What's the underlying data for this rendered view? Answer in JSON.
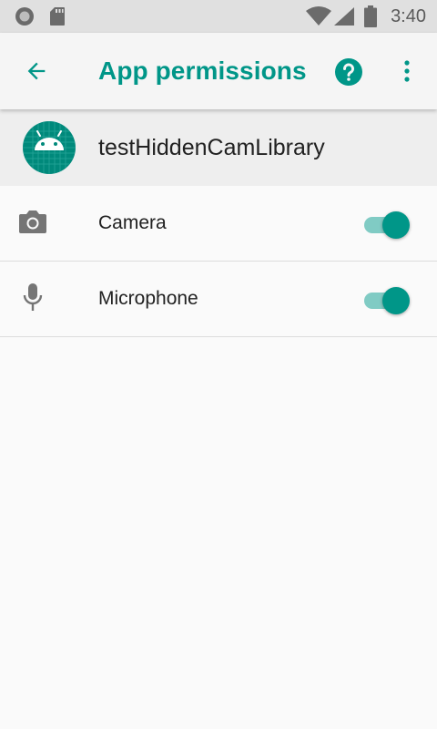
{
  "status_bar": {
    "time": "3:40",
    "icons": [
      "notification-dot-icon",
      "sd-card-icon",
      "wifi-icon",
      "cell-signal-icon",
      "battery-icon"
    ]
  },
  "app_bar": {
    "title": "App permissions",
    "back_icon": "arrow-back-icon",
    "help_icon": "help-icon",
    "menu_icon": "more-vert-icon"
  },
  "app": {
    "name": "testHiddenCamLibrary",
    "icon": "android-icon"
  },
  "permissions": [
    {
      "label": "Camera",
      "icon": "camera-icon",
      "enabled": true
    },
    {
      "label": "Microphone",
      "icon": "microphone-icon",
      "enabled": true
    }
  ],
  "colors": {
    "accent": "#009688",
    "toggle_track": "#80cbc4",
    "status_bar_bg": "#e0e0e0"
  }
}
